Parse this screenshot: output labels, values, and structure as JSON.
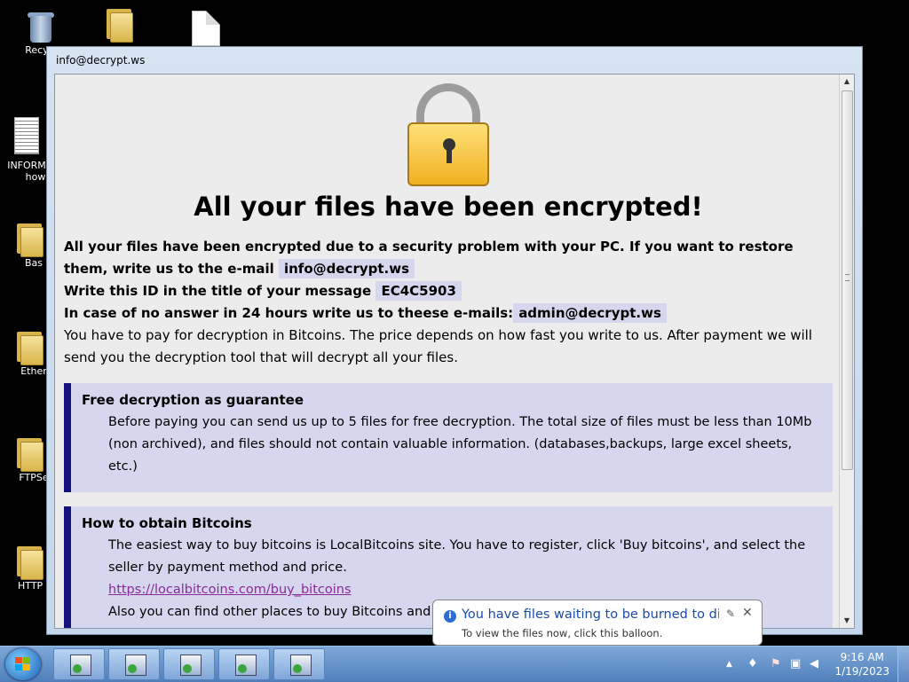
{
  "desktop": {
    "icons": [
      {
        "label": "Recycl"
      },
      {
        "label": ""
      },
      {
        "label": ""
      },
      {
        "label": "INFORM"
      },
      {
        "label": "how"
      },
      {
        "label": "Bas"
      },
      {
        "label": "Ether"
      },
      {
        "label": "FTPSe"
      },
      {
        "label": "HTTP ("
      }
    ]
  },
  "window": {
    "title": "info@decrypt.ws"
  },
  "note": {
    "heading": "All your files have been encrypted!",
    "line1": "All your files have been encrypted due to a security problem with your PC. If you want to restore them, write us to the e-mail",
    "email1": "info@decrypt.ws",
    "line2": "Write this ID in the title of your message",
    "id": "EC4C5903",
    "line3": "In case of no answer in 24 hours write us to theese e-mails:",
    "email2": "admin@decrypt.ws",
    "line4": "You have to pay for decryption in Bitcoins. The price depends on how fast you write to us. After payment we will send you the decryption tool that will decrypt all your files.",
    "box1": {
      "title": "Free decryption as guarantee",
      "text": "Before paying you can send us up to 5 files for free decryption. The total size of files must be less than 10Mb (non archived), and files should not contain valuable information. (databases,backups, large excel sheets, etc.)"
    },
    "box2": {
      "title": "How to obtain Bitcoins",
      "text": "The easiest way to buy bitcoins is LocalBitcoins site. You have to register, click 'Buy bitcoins', and select the seller by payment method and price.",
      "link": "https://localbitcoins.com/buy_bitcoins",
      "text2": "Also you can find other places to buy Bitcoins and beginn"
    }
  },
  "balloon": {
    "title": "You have files waiting to be burned to disc",
    "subtitle": "To view the files now, click this balloon."
  },
  "taskbar": {
    "time": "9:16 AM",
    "date": "1/19/2023"
  }
}
